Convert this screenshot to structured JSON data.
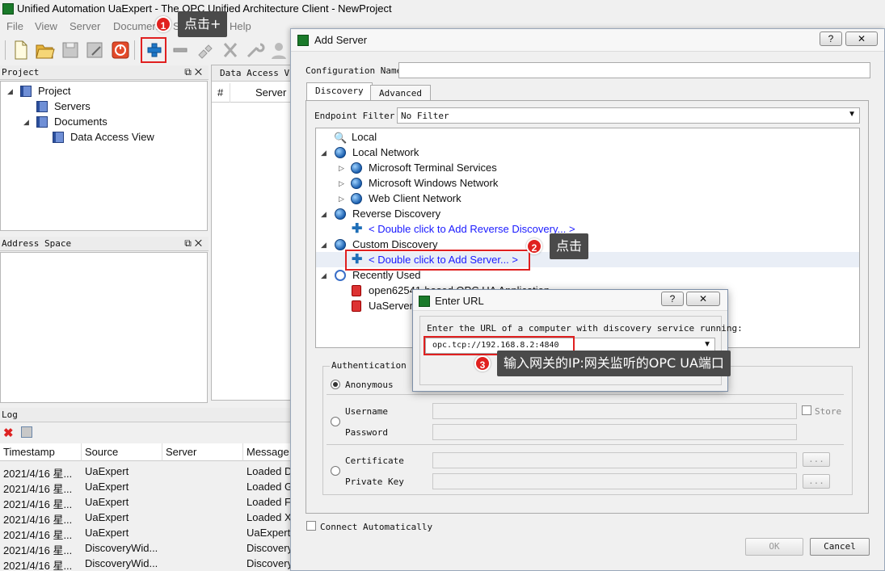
{
  "window": {
    "title": "Unified Automation UaExpert - The OPC Unified Architecture Client - NewProject"
  },
  "menu": [
    "File",
    "View",
    "Server",
    "Document",
    "S",
    "Help"
  ],
  "project_pane": {
    "title": "Project",
    "tree": [
      {
        "label": "Project",
        "level": 0
      },
      {
        "label": "Servers",
        "level": 1
      },
      {
        "label": "Documents",
        "level": 1
      },
      {
        "label": "Data Access View",
        "level": 2
      }
    ]
  },
  "address_pane": {
    "title": "Address Space"
  },
  "dav_pane": {
    "tab": "Data Access Vie",
    "col_num": "#",
    "col_server": "Server"
  },
  "log_pane": {
    "title": "Log",
    "columns": [
      "Timestamp",
      "Source",
      "Server",
      "Message"
    ],
    "rows": [
      [
        "2021/4/16 星...",
        "UaExpert",
        "",
        "Loaded D"
      ],
      [
        "2021/4/16 星...",
        "UaExpert",
        "",
        "Loaded G"
      ],
      [
        "2021/4/16 星...",
        "UaExpert",
        "",
        "Loaded F"
      ],
      [
        "2021/4/16 星...",
        "UaExpert",
        "",
        "Loaded X"
      ],
      [
        "2021/4/16 星...",
        "UaExpert",
        "",
        "UaExpert"
      ],
      [
        "2021/4/16 星...",
        "DiscoveryWid...",
        "",
        "Discovery"
      ],
      [
        "2021/4/16 星...",
        "DiscoveryWid...",
        "",
        "Discovery"
      ]
    ]
  },
  "add_server": {
    "title": "Add Server",
    "help": "?",
    "close": "✕",
    "config_name_label": "Configuration Name",
    "config_name_value": "",
    "tabs": [
      "Discovery",
      "Advanced"
    ],
    "endpoint_filter_label": "Endpoint Filter:",
    "endpoint_filter_value": "No Filter",
    "tree": {
      "local": "Local",
      "local_network": "Local Network",
      "ms_terminal": "Microsoft Terminal Services",
      "ms_windows": "Microsoft Windows Network",
      "web_client": "Web Client Network",
      "reverse": "Reverse Discovery",
      "reverse_add": "< Double click to Add Reverse Discovery... >",
      "custom": "Custom Discovery",
      "custom_add": "< Double click to Add Server... >",
      "recent": "Recently Used",
      "recent_1": "open62541-based OPC UA Application",
      "recent_2": "UaServer"
    },
    "auth_group": "Authentication Se",
    "anonymous": "Anonymous",
    "username": "Username",
    "password": "Password",
    "store": "Store",
    "certificate": "Certificate",
    "private_key": "Private Key",
    "browse": "...",
    "connect_auto": "Connect Automatically",
    "ok": "OK",
    "cancel": "Cancel"
  },
  "enter_url": {
    "title": "Enter URL",
    "help": "?",
    "close": "✕",
    "prompt": "Enter the URL of a computer with discovery service running:",
    "url_value": "opc.tcp://192.168.8.2:4840"
  },
  "annotations": {
    "a1_num": "1",
    "a1_text": "点击+",
    "a2_num": "2",
    "a2_text": "点击",
    "a3_num": "3",
    "a3_text": "输入网关的IP:网关监听的OPC UA端口"
  }
}
